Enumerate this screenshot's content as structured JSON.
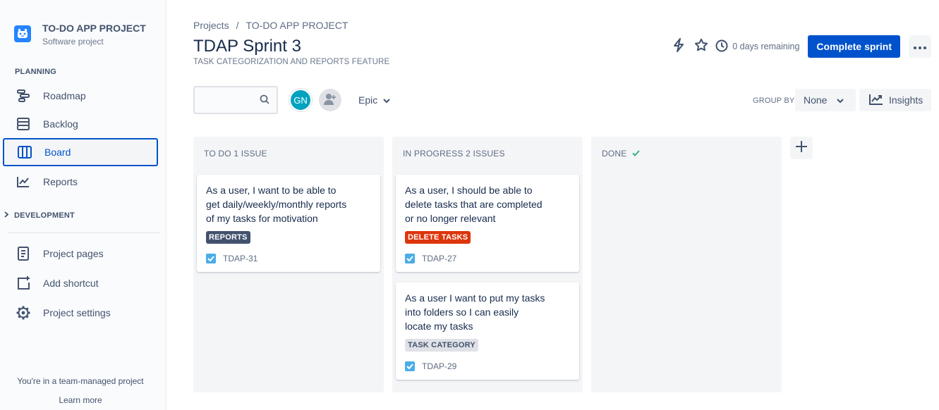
{
  "project": {
    "name": "TO-DO APP PROJECT",
    "type": "Software project"
  },
  "sidebar": {
    "planning_label": "PLANNING",
    "items": [
      {
        "label": "Roadmap",
        "icon": "roadmap-icon"
      },
      {
        "label": "Backlog",
        "icon": "backlog-icon"
      },
      {
        "label": "Board",
        "icon": "board-icon",
        "active": true
      },
      {
        "label": "Reports",
        "icon": "reports-icon"
      }
    ],
    "development_label": "DEVELOPMENT",
    "extra": [
      {
        "label": "Project pages",
        "icon": "page-icon"
      },
      {
        "label": "Add shortcut",
        "icon": "add-shortcut-icon"
      },
      {
        "label": "Project settings",
        "icon": "gear-icon"
      }
    ],
    "footer_text": "You're in a team-managed project",
    "learn_more": "Learn more"
  },
  "header": {
    "breadcrumb": [
      "Projects",
      "/",
      "TO-DO APP PROJECT"
    ],
    "title": "TDAP Sprint 3",
    "subtitle": "TASK CATEGORIZATION AND REPORTS FEATURE",
    "remaining": "0 days remaining",
    "complete_sprint": "Complete sprint"
  },
  "filters": {
    "search_placeholder": "",
    "avatar_initials": "GN",
    "epic_label": "Epic",
    "group_by_label": "GROUP BY",
    "group_by_value": "None",
    "insights_label": "Insights"
  },
  "columns": [
    {
      "title": "TO DO 1 ISSUE",
      "cards": [
        {
          "summary": "As a user, I want to be able to get daily/weekly/monthly reports of my tasks for motivation",
          "label": "REPORTS",
          "key": "TDAP-31"
        }
      ]
    },
    {
      "title": "IN PROGRESS 2 ISSUES",
      "cards": [
        {
          "summary": "As a user, I should be able to delete tasks that are completed or no longer relevant",
          "label": "DELETE TASKS",
          "key": "TDAP-27"
        },
        {
          "summary": "As a user I want to put my tasks into folders so I can easily locate my tasks",
          "label": "TASK CATEGORY",
          "key": "TDAP-29"
        }
      ]
    },
    {
      "title": "DONE",
      "cards": []
    }
  ],
  "colors": {
    "primary": "#0052cc",
    "reports_label": "#42526e",
    "delete_label": "#de350b",
    "category_label": "#dfe1e6",
    "done_check": "#36b37e"
  }
}
